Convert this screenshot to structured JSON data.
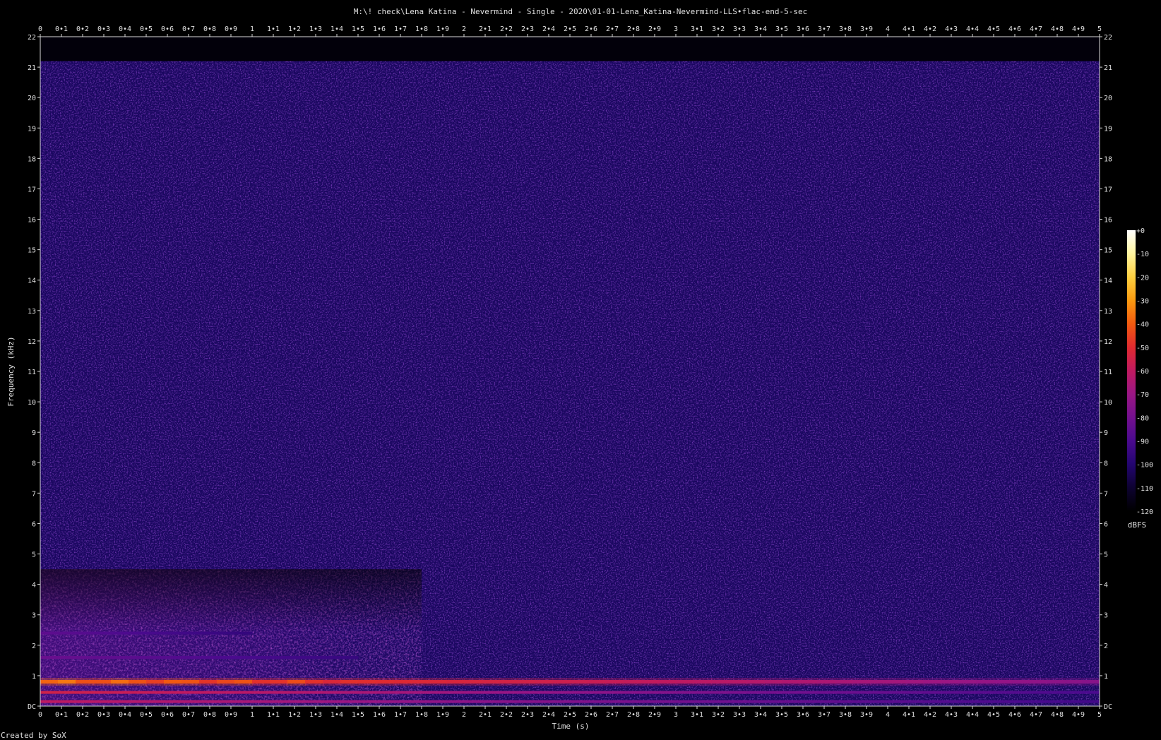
{
  "chart_data": {
    "type": "heatmap",
    "title": "M:\\! check\\Lena Katina - Nevermind - Single - 2020\\01-01-Lena_Katina-Nevermind-LLS•flac-end-5-sec",
    "xlabel": "Time (s)",
    "ylabel": "Frequency (kHz)",
    "footer": "Created by SoX",
    "xlim": [
      0,
      5
    ],
    "ylim": [
      0,
      22
    ],
    "x_ticks": [
      "0",
      "0•1",
      "0•2",
      "0•3",
      "0•4",
      "0•5",
      "0•6",
      "0•7",
      "0•8",
      "0•9",
      "1",
      "1•1",
      "1•2",
      "1•3",
      "1•4",
      "1•5",
      "1•6",
      "1•7",
      "1•8",
      "1•9",
      "2",
      "2•1",
      "2•2",
      "2•3",
      "2•4",
      "2•5",
      "2•6",
      "2•7",
      "2•8",
      "2•9",
      "3",
      "3•1",
      "3•2",
      "3•3",
      "3•4",
      "3•5",
      "3•6",
      "3•7",
      "3•8",
      "3•9",
      "4",
      "4•1",
      "4•2",
      "4•3",
      "4•4",
      "4•5",
      "4•6",
      "4•7",
      "4•8",
      "4•9",
      "5"
    ],
    "y_ticks": [
      "DC",
      "1",
      "2",
      "3",
      "4",
      "5",
      "6",
      "7",
      "8",
      "9",
      "10",
      "11",
      "12",
      "13",
      "14",
      "15",
      "16",
      "17",
      "18",
      "19",
      "20",
      "21",
      "22"
    ],
    "colorbar": {
      "label": "dBFS",
      "ticks": [
        "+0",
        "-10",
        "-20",
        "-30",
        "-40",
        "-50",
        "-60",
        "-70",
        "-80",
        "-90",
        "-100",
        "-110",
        "-120"
      ],
      "range": [
        -120,
        0
      ],
      "colors": [
        "#000000",
        "#0d0230",
        "#230570",
        "#4a0a8e",
        "#73108e",
        "#9a1684",
        "#c01a60",
        "#e02a30",
        "#f25a10",
        "#fa9a10",
        "#fdd040",
        "#fff5a0",
        "#ffffff"
      ]
    },
    "noise_floor_khz": 21.2,
    "bands": [
      {
        "freq_khz": 0.8,
        "start_s": 0,
        "end_s": 5,
        "level_start_db": -38,
        "level_end_db": -75
      },
      {
        "freq_khz": 0.45,
        "start_s": 0,
        "end_s": 5,
        "level_start_db": -55,
        "level_end_db": -90
      },
      {
        "freq_khz": 0.15,
        "start_s": 0,
        "end_s": 5,
        "level_start_db": -60,
        "level_end_db": -92
      },
      {
        "freq_khz": 1.6,
        "start_s": 0,
        "end_s": 1.5,
        "level_start_db": -82,
        "level_end_db": -95
      },
      {
        "freq_khz": 2.4,
        "start_s": 0,
        "end_s": 1.0,
        "level_start_db": -85,
        "level_end_db": -96
      }
    ],
    "energy_region": {
      "max_freq_khz": 4.5,
      "start_s": 0,
      "end_s": 1.8,
      "level_db": -88
    }
  }
}
